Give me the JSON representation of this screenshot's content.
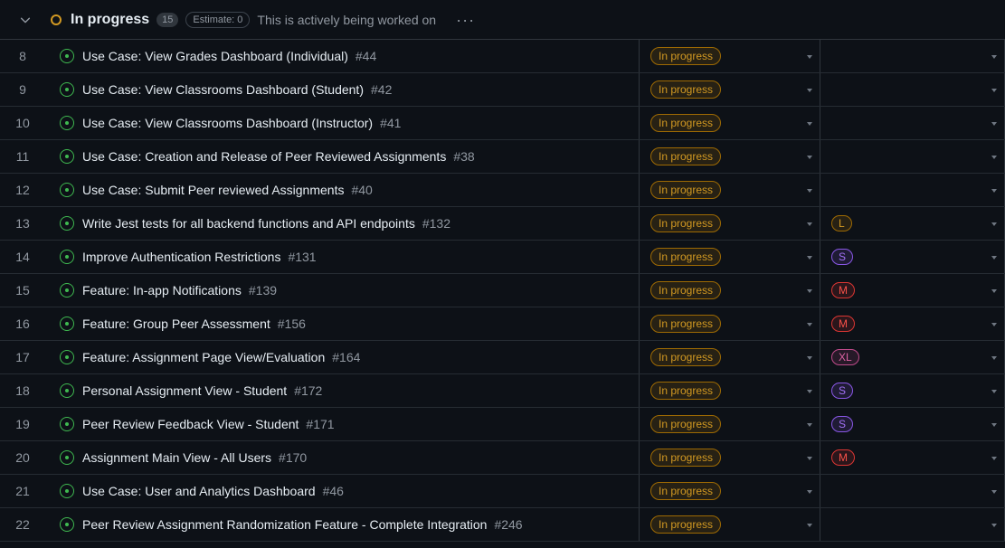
{
  "group": {
    "title": "In progress",
    "count": "15",
    "estimate": "Estimate: 0",
    "description": "This is actively being worked on",
    "more": "···"
  },
  "colors": {
    "status_accent": "#d29922",
    "open_issue": "#3fb950"
  },
  "icons": [
    "chevron-down-icon",
    "issue-opened-icon",
    "kebab-menu-icon",
    "dropdown-caret-icon"
  ],
  "rows": [
    {
      "num": "8",
      "title": "Use Case: View Grades Dashboard (Individual)",
      "issue": "#44",
      "status": "In progress",
      "size": ""
    },
    {
      "num": "9",
      "title": "Use Case: View Classrooms Dashboard (Student)",
      "issue": "#42",
      "status": "In progress",
      "size": ""
    },
    {
      "num": "10",
      "title": "Use Case: View Classrooms Dashboard (Instructor)",
      "issue": "#41",
      "status": "In progress",
      "size": ""
    },
    {
      "num": "11",
      "title": "Use Case: Creation and Release of Peer Reviewed Assignments",
      "issue": "#38",
      "status": "In progress",
      "size": ""
    },
    {
      "num": "12",
      "title": "Use Case: Submit Peer reviewed Assignments",
      "issue": "#40",
      "status": "In progress",
      "size": ""
    },
    {
      "num": "13",
      "title": "Write Jest tests for all backend functions and API endpoints",
      "issue": "#132",
      "status": "In progress",
      "size": "L"
    },
    {
      "num": "14",
      "title": "Improve Authentication Restrictions",
      "issue": "#131",
      "status": "In progress",
      "size": "S"
    },
    {
      "num": "15",
      "title": "Feature: In-app Notifications",
      "issue": "#139",
      "status": "In progress",
      "size": "M"
    },
    {
      "num": "16",
      "title": "Feature: Group Peer Assessment",
      "issue": "#156",
      "status": "In progress",
      "size": "M"
    },
    {
      "num": "17",
      "title": "Feature: Assignment Page View/Evaluation",
      "issue": "#164",
      "status": "In progress",
      "size": "XL"
    },
    {
      "num": "18",
      "title": "Personal Assignment View - Student",
      "issue": "#172",
      "status": "In progress",
      "size": "S"
    },
    {
      "num": "19",
      "title": "Peer Review Feedback View - Student",
      "issue": "#171",
      "status": "In progress",
      "size": "S"
    },
    {
      "num": "20",
      "title": "Assignment Main View - All Users",
      "issue": "#170",
      "status": "In progress",
      "size": "M"
    },
    {
      "num": "21",
      "title": "Use Case: User and Analytics Dashboard",
      "issue": "#46",
      "status": "In progress",
      "size": ""
    },
    {
      "num": "22",
      "title": "Peer Review Assignment Randomization Feature - Complete Integration",
      "issue": "#246",
      "status": "In progress",
      "size": ""
    }
  ]
}
